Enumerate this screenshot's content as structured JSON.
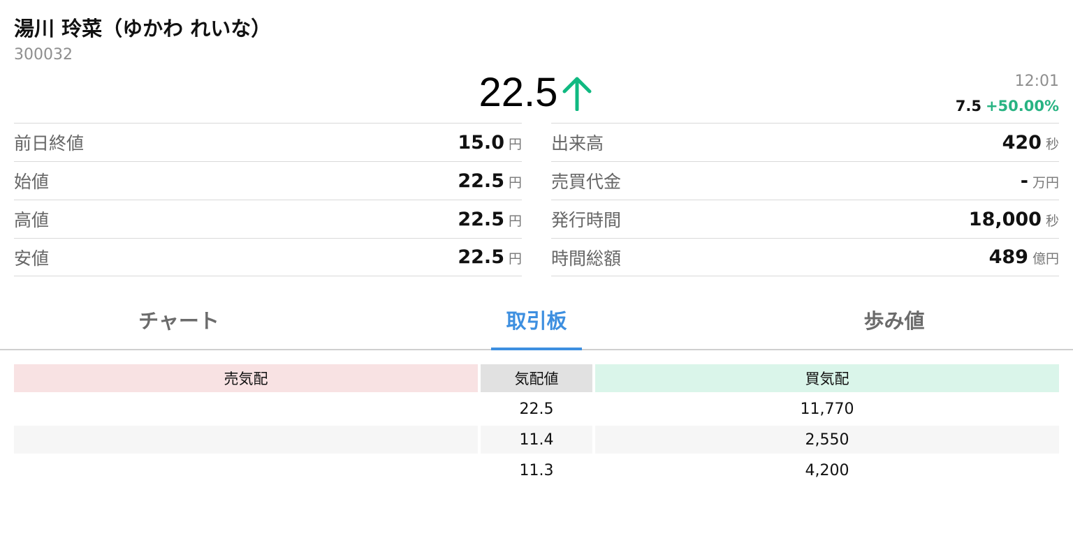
{
  "header": {
    "name": "湯川 玲菜（ゆかわ れいな）",
    "code": "300032",
    "price": "22.5",
    "time": "12:01",
    "change_value": "7.5",
    "change_percent": "+50.00%"
  },
  "colors": {
    "up": "#10b981",
    "accent": "#3d8fe0",
    "sell_header": "#f8e2e3",
    "buy_header": "#daf5ea"
  },
  "stats_left": [
    {
      "label": "前日終値",
      "value": "15.0",
      "unit": "円"
    },
    {
      "label": "始値",
      "value": "22.5",
      "unit": "円"
    },
    {
      "label": "高値",
      "value": "22.5",
      "unit": "円"
    },
    {
      "label": "安値",
      "value": "22.5",
      "unit": "円"
    }
  ],
  "stats_right": [
    {
      "label": "出来高",
      "value": "420",
      "unit": "秒"
    },
    {
      "label": "売買代金",
      "value": "-",
      "unit": "万円"
    },
    {
      "label": "発行時間",
      "value": "18,000",
      "unit": "秒"
    },
    {
      "label": "時間総額",
      "value": "489",
      "unit": "億円"
    }
  ],
  "tabs": [
    {
      "label": "チャート",
      "active": false
    },
    {
      "label": "取引板",
      "active": true
    },
    {
      "label": "歩み値",
      "active": false
    }
  ],
  "board": {
    "headers": {
      "sell": "売気配",
      "price": "気配値",
      "buy": "買気配"
    },
    "rows": [
      {
        "sell": "",
        "price": "22.5",
        "buy": "11,770"
      },
      {
        "sell": "",
        "price": "11.4",
        "buy": "2,550"
      },
      {
        "sell": "",
        "price": "11.3",
        "buy": "4,200"
      }
    ]
  }
}
